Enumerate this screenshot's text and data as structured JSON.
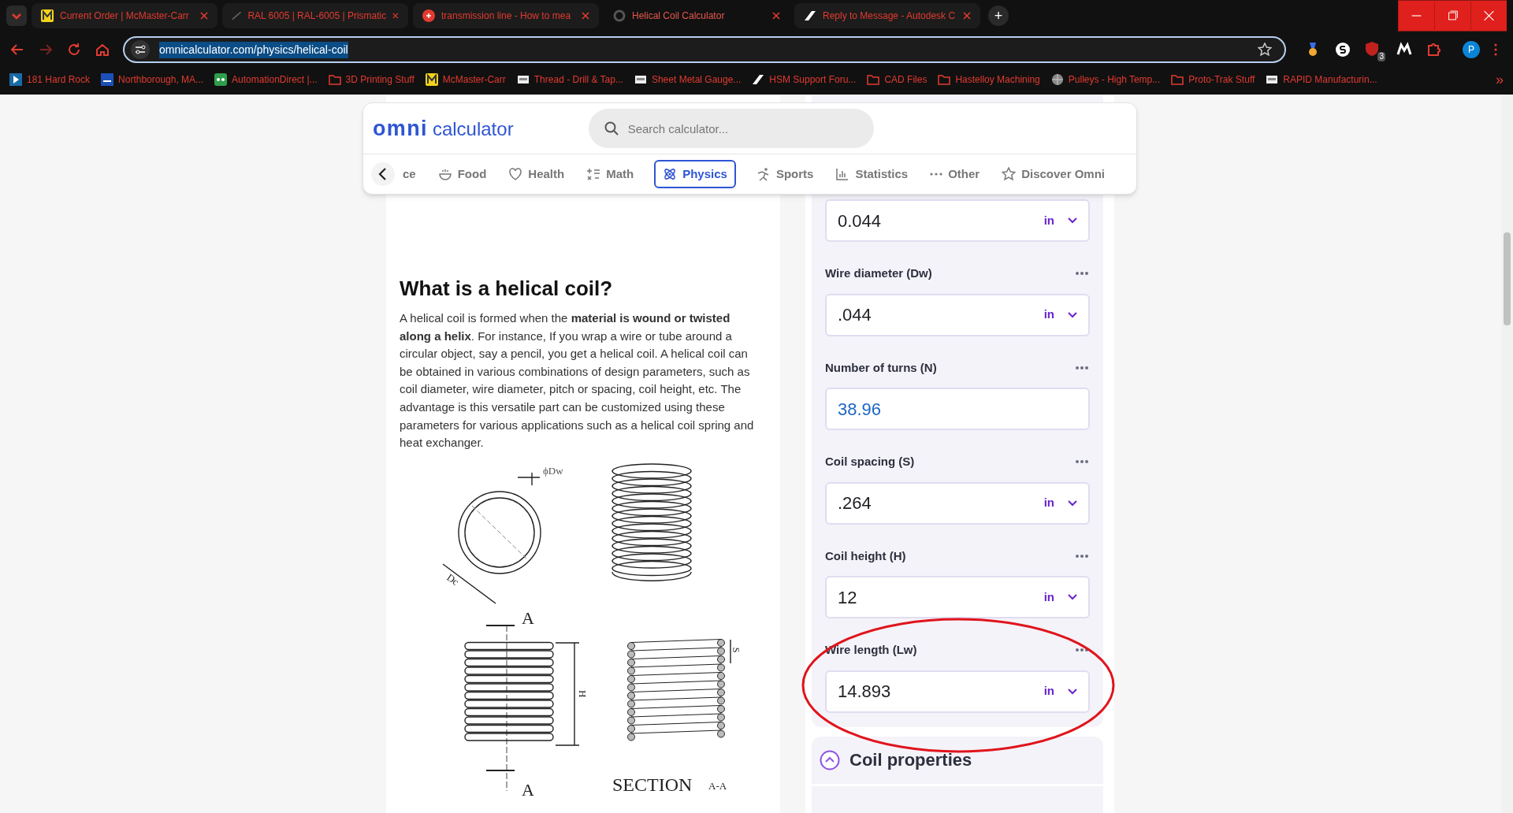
{
  "browser": {
    "tabs": [
      {
        "title": "Current Order | McMaster-Carr",
        "selected": false
      },
      {
        "title": "RAL 6005 | RAL-6005 | Prismatic",
        "selected": false
      },
      {
        "title": "transmission line - How to mea",
        "selected": false
      },
      {
        "title": "Helical Coil Calculator",
        "selected": true
      },
      {
        "title": "Reply to Message - Autodesk C",
        "selected": false
      }
    ],
    "new_tab": "+",
    "address": "omnicalculator.com/physics/helical-coil",
    "extension_badge": "3",
    "profile": "P",
    "bookmarks": [
      {
        "label": "181 Hard Rock"
      },
      {
        "label": "Northborough, MA..."
      },
      {
        "label": "AutomationDirect |..."
      },
      {
        "label": "3D Printing Stuff"
      },
      {
        "label": "McMaster-Carr"
      },
      {
        "label": "Thread - Drill & Tap..."
      },
      {
        "label": "Sheet Metal Gauge..."
      },
      {
        "label": "HSM Support Foru..."
      },
      {
        "label": "CAD Files"
      },
      {
        "label": "Hastelloy Machining"
      },
      {
        "label": "Pulleys - High Temp..."
      },
      {
        "label": "Proto-Trak Stuff"
      },
      {
        "label": "RAPID Manufacturin..."
      }
    ],
    "more_bookmarks": "»"
  },
  "header": {
    "logo_brand": "omni",
    "logo_word": "calculator",
    "search_placeholder": "Search calculator...",
    "categories": [
      {
        "label": "ce",
        "selected": false
      },
      {
        "label": "Food",
        "selected": false
      },
      {
        "label": "Health",
        "selected": false
      },
      {
        "label": "Math",
        "selected": false
      },
      {
        "label": "Physics",
        "selected": true
      },
      {
        "label": "Sports",
        "selected": false
      },
      {
        "label": "Statistics",
        "selected": false
      },
      {
        "label": "Other",
        "selected": false
      },
      {
        "label": "Discover Omni",
        "selected": false
      }
    ]
  },
  "article": {
    "heading": "What is a helical coil?",
    "paragraph": "A helical coil is formed when the **material is wound or twisted along a helix**. For instance, If you wrap a wire or tube around a circular object, say a pencil, you get a helical coil. A helical coil can be obtained in various combinations of design parameters, such as coil diameter, wire diameter, pitch or spacing, coil height, etc. The advantage is this versatile part can be customized using these parameters for various applications such as a helical coil spring and heat exchanger.",
    "figure_labels": {
      "dw": "ϕDw",
      "dc": "Dc",
      "section_top": "A",
      "section_bottom": "A",
      "height": "H",
      "spacing": "S",
      "section_title": "SECTION",
      "section_suffix": "A-A"
    }
  },
  "calculator": {
    "fields": [
      {
        "value": "0.044",
        "unit": "in",
        "computed": false
      },
      {
        "label": "Wire diameter (Dw)",
        "value": ".044",
        "unit": "in",
        "computed": false
      },
      {
        "label": "Number of turns (N)",
        "value": "38.96",
        "computed": true
      },
      {
        "label": "Coil spacing (S)",
        "value": ".264",
        "unit": "in",
        "computed": false
      },
      {
        "label": "Coil height (H)",
        "value": "12",
        "unit": "in",
        "computed": false
      },
      {
        "label": "Wire length (Lw)",
        "value": "14.893",
        "unit": "in",
        "computed": false,
        "circled": true
      }
    ],
    "section": {
      "title": "Coil properties",
      "expanded": true
    }
  }
}
